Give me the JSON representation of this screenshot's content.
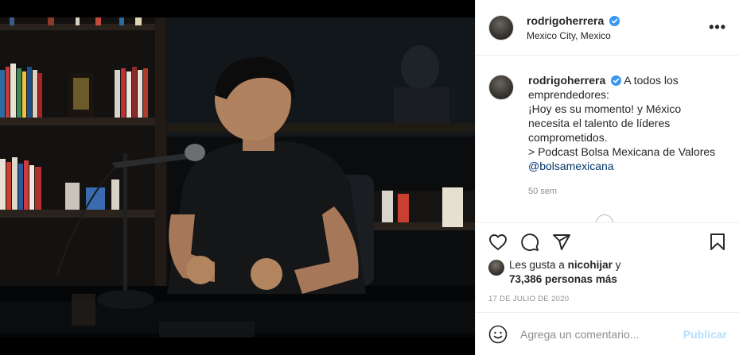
{
  "header": {
    "username": "rodrigoherrera",
    "location": "Mexico City, Mexico",
    "more_icon": "ellipsis-icon"
  },
  "caption": {
    "username": "rodrigoherrera",
    "lines": [
      "A todos los",
      "emprendedores:",
      "¡Hoy es su momento! y México",
      "necesita el talento de líderes",
      "comprometidos.",
      "> Podcast Bolsa Mexicana de Valores"
    ],
    "mention": "@bolsamexicana",
    "age": "50 sem"
  },
  "actions": {
    "like_icon": "heart-icon",
    "comment_icon": "comment-bubble-icon",
    "share_icon": "paper-plane-icon",
    "save_icon": "bookmark-icon"
  },
  "likes": {
    "prefix": "Les gusta a",
    "user": "nicohijar",
    "and": "y",
    "count": "73,386 personas más"
  },
  "date": "17 DE JULIO DE 2020",
  "comment_box": {
    "placeholder": "Agrega un comentario...",
    "publish_label": "Publicar",
    "emoji_icon": "smiley-icon"
  },
  "colors": {
    "verified_blue": "#3897f0",
    "link_blue": "#00376b",
    "publish_disabled": "#b2dffc",
    "muted_text": "#8e8e8e"
  }
}
